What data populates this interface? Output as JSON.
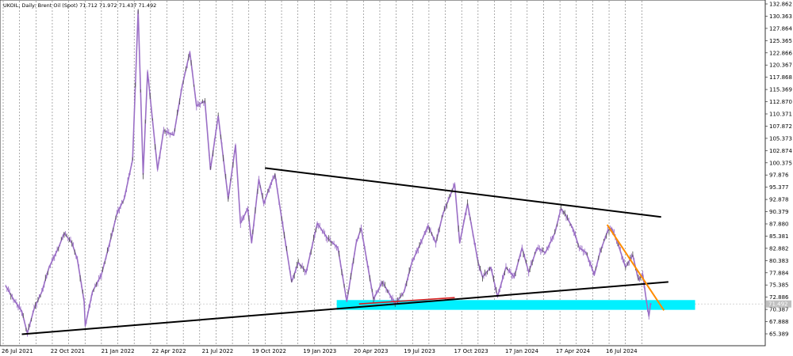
{
  "chart_data": {
    "type": "line",
    "title": "UKOIL, Daily:  Brent Oil (Spot)  71.712 71.972 71.437 71.492",
    "price_label": "71.492",
    "ylim": [
      64.0,
      133.7
    ],
    "y_ticks": [
      "132.862",
      "130.363",
      "127.864",
      "125.365",
      "122.866",
      "120.367",
      "117.868",
      "115.369",
      "112.870",
      "110.371",
      "107.872",
      "105.373",
      "102.874",
      "100.375",
      "97.876",
      "95.377",
      "92.878",
      "90.379",
      "87.880",
      "85.381",
      "82.882",
      "80.383",
      "77.884",
      "75.385",
      "72.886",
      "70.387",
      "67.888",
      "65.389"
    ],
    "x_ticks": [
      {
        "label": "26 Jul 2021",
        "date": "2021-07-26"
      },
      {
        "label": "22 Oct 2021",
        "date": "2021-10-22"
      },
      {
        "label": "21 Jan 2022",
        "date": "2022-01-21"
      },
      {
        "label": "22 Apr 2022",
        "date": "2022-04-22"
      },
      {
        "label": "21 Jul 2022",
        "date": "2022-07-21"
      },
      {
        "label": "19 Oct 2022",
        "date": "2022-10-19"
      },
      {
        "label": "19 Jan 2023",
        "date": "2023-01-19"
      },
      {
        "label": "20 Apr 2023",
        "date": "2023-04-20"
      },
      {
        "label": "19 Jul 2023",
        "date": "2023-07-19"
      },
      {
        "label": "17 Oct 2023",
        "date": "2023-10-17"
      },
      {
        "label": "17 Jan 2024",
        "date": "2024-01-17"
      },
      {
        "label": "17 Apr 2024",
        "date": "2024-04-17"
      },
      {
        "label": "16 Jul 2024",
        "date": "2024-07-16"
      }
    ],
    "grid": true,
    "series": [
      {
        "color": "#9b6fc6",
        "points": [
          [
            "2021-07-12",
            75.2
          ],
          [
            "2021-07-26",
            72.5
          ],
          [
            "2021-08-10",
            70.0
          ],
          [
            "2021-08-20",
            65.5
          ],
          [
            "2021-09-01",
            70.5
          ],
          [
            "2021-09-15",
            74.0
          ],
          [
            "2021-09-28",
            79.0
          ],
          [
            "2021-10-15",
            83.0
          ],
          [
            "2021-10-25",
            86.0
          ],
          [
            "2021-11-08",
            84.0
          ],
          [
            "2021-11-18",
            80.5
          ],
          [
            "2021-11-30",
            72.0
          ],
          [
            "2021-12-02",
            67.0
          ],
          [
            "2021-12-15",
            74.0
          ],
          [
            "2021-12-31",
            77.5
          ],
          [
            "2022-01-15",
            84.0
          ],
          [
            "2022-01-28",
            90.0
          ],
          [
            "2022-02-10",
            93.0
          ],
          [
            "2022-02-25",
            101.0
          ],
          [
            "2022-03-07",
            131.5
          ],
          [
            "2022-03-16",
            98.0
          ],
          [
            "2022-03-24",
            119.0
          ],
          [
            "2022-04-11",
            99.0
          ],
          [
            "2022-04-22",
            107.0
          ],
          [
            "2022-05-10",
            106.0
          ],
          [
            "2022-05-25",
            116.0
          ],
          [
            "2022-06-08",
            123.0
          ],
          [
            "2022-06-20",
            112.0
          ],
          [
            "2022-07-05",
            113.0
          ],
          [
            "2022-07-15",
            99.0
          ],
          [
            "2022-07-29",
            110.0
          ],
          [
            "2022-08-16",
            93.0
          ],
          [
            "2022-08-29",
            104.0
          ],
          [
            "2022-09-07",
            88.0
          ],
          [
            "2022-09-20",
            91.0
          ],
          [
            "2022-09-27",
            84.0
          ],
          [
            "2022-10-10",
            97.0
          ],
          [
            "2022-10-19",
            92.0
          ],
          [
            "2022-10-31",
            96.0
          ],
          [
            "2022-11-08",
            98.0
          ],
          [
            "2022-11-20",
            89.0
          ],
          [
            "2022-12-08",
            76.0
          ],
          [
            "2022-12-20",
            80.0
          ],
          [
            "2023-01-03",
            78.0
          ],
          [
            "2023-01-23",
            88.0
          ],
          [
            "2023-02-10",
            85.0
          ],
          [
            "2023-03-01",
            83.0
          ],
          [
            "2023-03-17",
            72.0
          ],
          [
            "2023-04-03",
            84.0
          ],
          [
            "2023-04-12",
            87.0
          ],
          [
            "2023-05-04",
            72.5
          ],
          [
            "2023-05-20",
            76.0
          ],
          [
            "2023-06-12",
            71.5
          ],
          [
            "2023-06-28",
            74.0
          ],
          [
            "2023-07-12",
            80.0
          ],
          [
            "2023-07-28",
            84.0
          ],
          [
            "2023-08-10",
            87.5
          ],
          [
            "2023-08-24",
            84.0
          ],
          [
            "2023-09-06",
            90.0
          ],
          [
            "2023-09-27",
            96.0
          ],
          [
            "2023-10-06",
            84.0
          ],
          [
            "2023-10-20",
            92.0
          ],
          [
            "2023-11-08",
            80.0
          ],
          [
            "2023-11-16",
            77.0
          ],
          [
            "2023-12-01",
            79.0
          ],
          [
            "2023-12-13",
            73.0
          ],
          [
            "2023-12-28",
            79.0
          ],
          [
            "2024-01-12",
            77.0
          ],
          [
            "2024-01-26",
            83.0
          ],
          [
            "2024-02-07",
            78.0
          ],
          [
            "2024-02-22",
            83.0
          ],
          [
            "2024-03-08",
            82.0
          ],
          [
            "2024-03-25",
            86.0
          ],
          [
            "2024-04-05",
            91.0
          ],
          [
            "2024-04-12",
            90.0
          ],
          [
            "2024-04-26",
            87.0
          ],
          [
            "2024-05-08",
            83.0
          ],
          [
            "2024-05-20",
            82.0
          ],
          [
            "2024-06-04",
            77.5
          ],
          [
            "2024-06-14",
            82.0
          ],
          [
            "2024-06-28",
            86.5
          ],
          [
            "2024-07-05",
            87.0
          ],
          [
            "2024-07-16",
            84.0
          ],
          [
            "2024-07-30",
            79.0
          ],
          [
            "2024-08-12",
            81.5
          ],
          [
            "2024-08-22",
            76.5
          ],
          [
            "2024-08-30",
            77.5
          ],
          [
            "2024-09-05",
            72.5
          ],
          [
            "2024-09-10",
            69.0
          ],
          [
            "2024-09-13",
            71.5
          ]
        ]
      }
    ],
    "overlays": [
      {
        "kind": "trendline",
        "color": "#000000",
        "from": [
          "2022-10-21",
          99.3
        ],
        "to": [
          "2024-10-02",
          89.3
        ]
      },
      {
        "kind": "trendline",
        "color": "#000000",
        "from": [
          "2021-08-10",
          65.3
        ],
        "to": [
          "2024-10-15",
          76.0
        ]
      },
      {
        "kind": "trendline",
        "color": "#ff8c00",
        "from": [
          "2024-06-27",
          87.7
        ],
        "to": [
          "2024-10-07",
          70.2
        ]
      },
      {
        "kind": "trendline",
        "color": "#d81e1e",
        "from": [
          "2023-04-08",
          71.5
        ],
        "to": [
          "2023-09-27",
          72.8
        ]
      },
      {
        "kind": "zone",
        "color": "#00f0ff",
        "from": "2023-02-27",
        "to": "2024-12-02",
        "y_range": [
          70.3,
          72.3
        ]
      }
    ]
  }
}
